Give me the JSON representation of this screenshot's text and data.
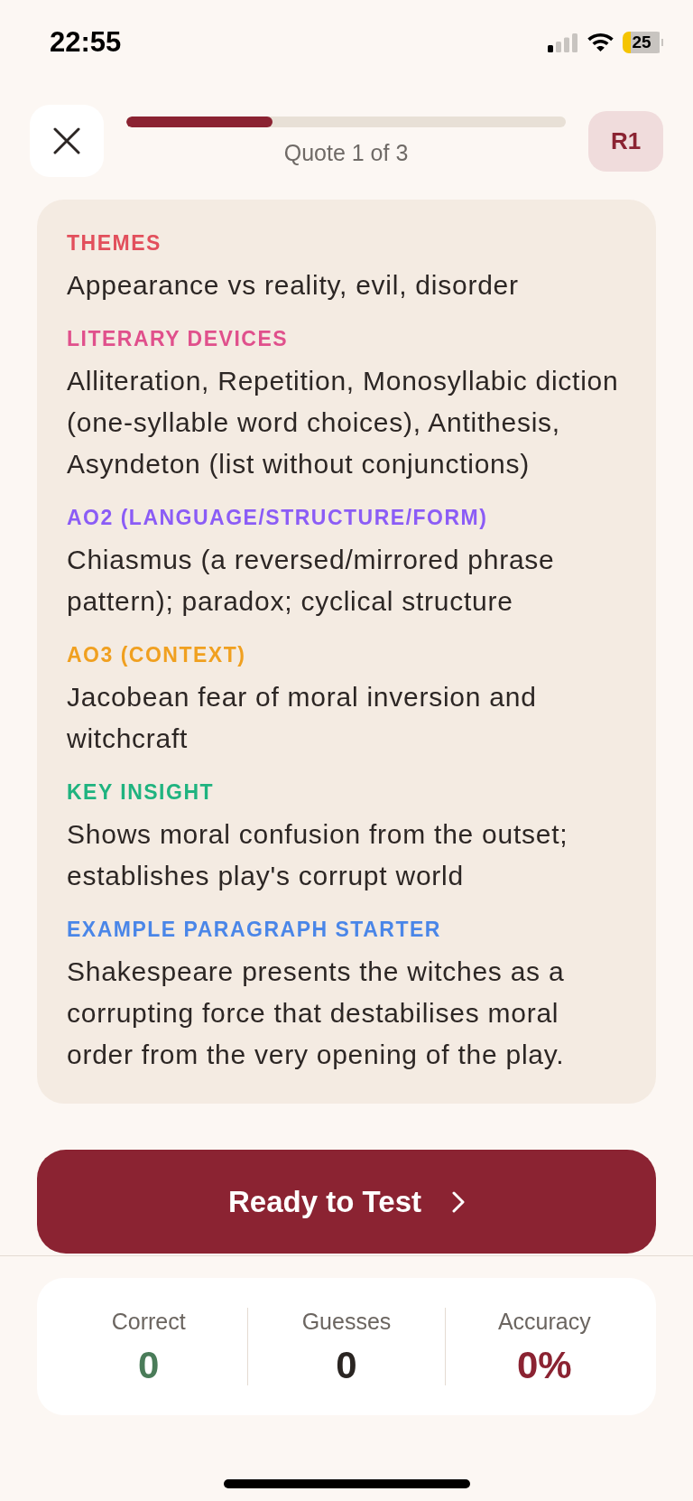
{
  "status_bar": {
    "time": "22:55",
    "battery": "25"
  },
  "header": {
    "progress": {
      "level": 0.333
    },
    "progress_label": "Quote 1 of 3",
    "badge": "R1"
  },
  "sections": [
    {
      "title": "THEMES",
      "color": "#e24f5c",
      "text": "Appearance vs reality, evil, disorder"
    },
    {
      "title": "LITERARY DEVICES",
      "color": "#e0508c",
      "text": "Alliteration, Repetition, Monosyllabic diction (one-syllable word choices), Antithesis, Asyndeton (list without conjunctions)"
    },
    {
      "title": "AO2 (LANGUAGE/STRUCTURE/FORM)",
      "color": "#8b5cf6",
      "text": "Chiasmus (a reversed/mirrored phrase pattern); paradox; cyclical structure"
    },
    {
      "title": "AO3 (CONTEXT)",
      "color": "#f0a020",
      "text": "Jacobean fear of moral inversion and witchcraft"
    },
    {
      "title": "KEY INSIGHT",
      "color": "#1fb37f",
      "text": "Shows moral confusion from the outset; establishes play's corrupt world"
    },
    {
      "title": "EXAMPLE PARAGRAPH STARTER",
      "color": "#4a86e8",
      "text": "Shakespeare presents the witches as a corrupting force that destabilises moral order from the very opening of the play."
    }
  ],
  "primary_button": {
    "label": "Ready to Test"
  },
  "stats": [
    {
      "label": "Correct",
      "value": "0",
      "color": "#4a7c59"
    },
    {
      "label": "Guesses",
      "value": "0",
      "color": "#2a2522"
    },
    {
      "label": "Accuracy",
      "value": "0%",
      "color": "#8b2332"
    }
  ]
}
